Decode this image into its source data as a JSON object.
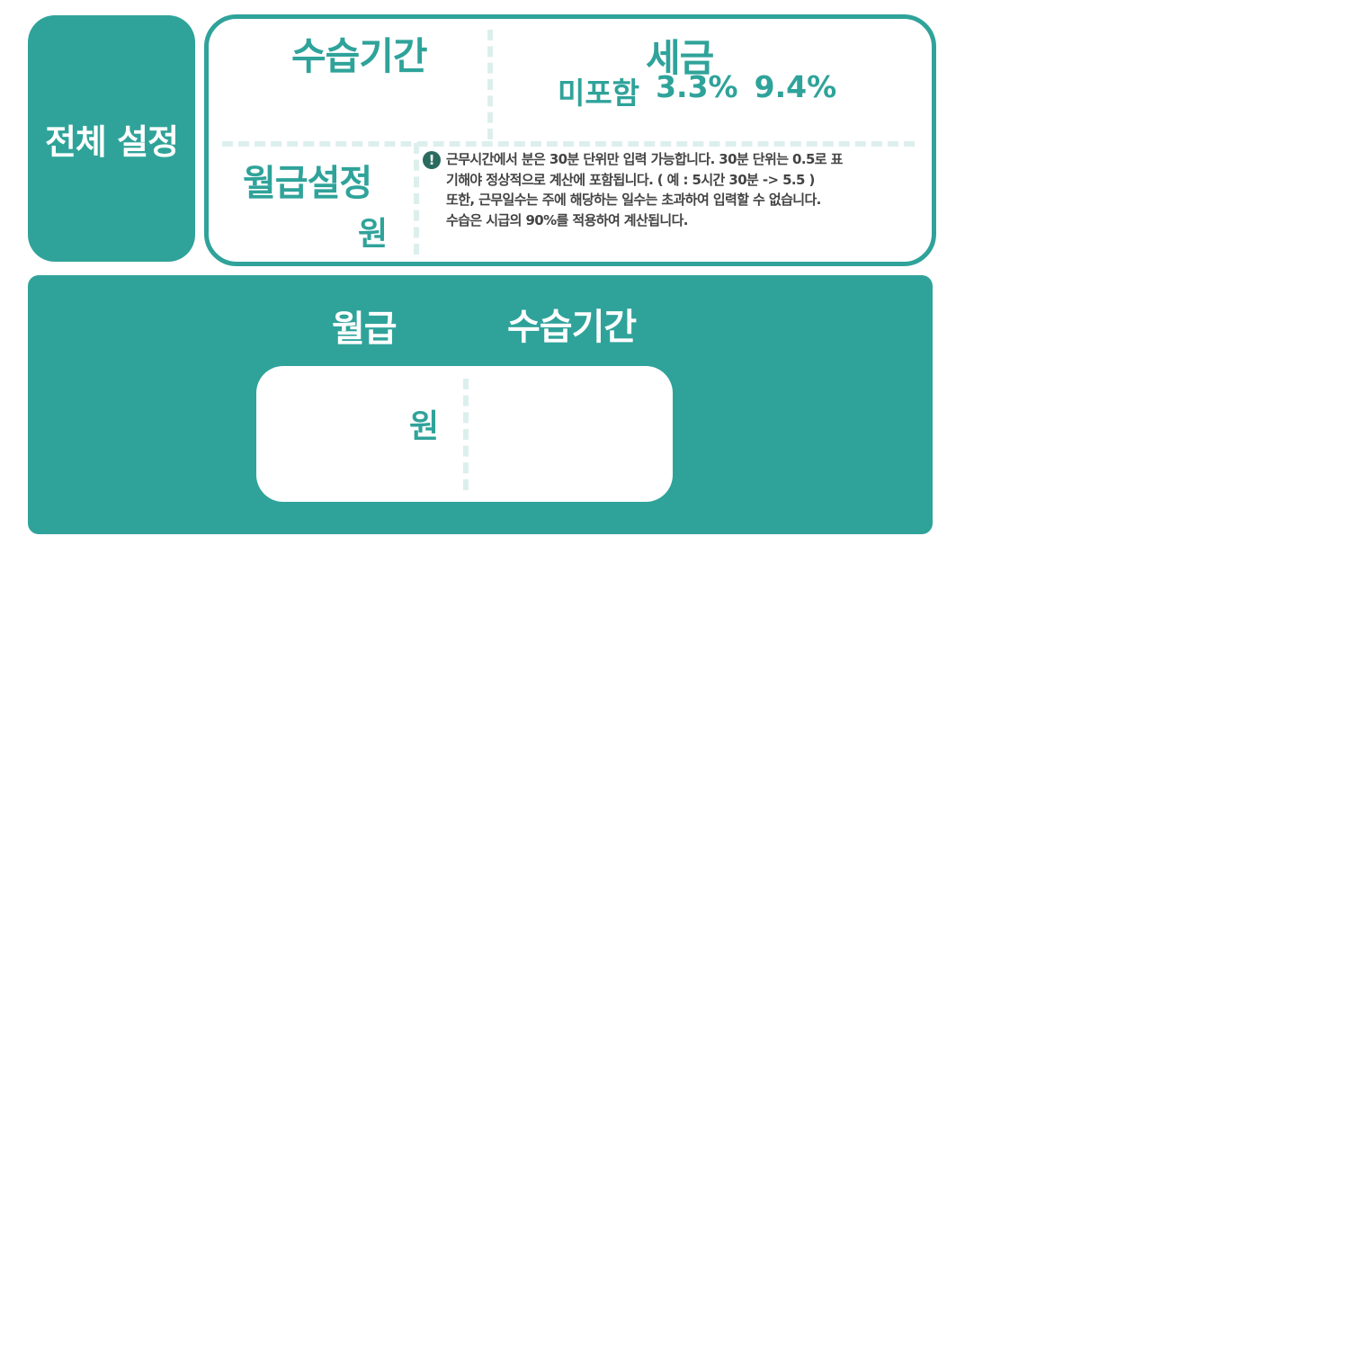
{
  "badge": {
    "label": "전체 설정"
  },
  "settings": {
    "probation_title": "수습기간",
    "tax_title": "세금",
    "tax_options": [
      "미포함",
      "3.3%",
      "9.4%"
    ],
    "salary_setting_title": "월급설정",
    "currency_unit": "원",
    "notice_icon": "!",
    "notice_lines": [
      "근무시간에서 분은 30분 단위만 입력 가능합니다. 30분 단위는 0.5로 표",
      "기해야 정상적으로 계산에 포함됩니다. ( 예 : 5시간 30분 -> 5.5 )",
      "또한, 근무일수는 주에 해당하는 일수는 초과하여 입력할 수 없습니다.",
      "수습은 시급의 90%를 적용하여 계산됩니다."
    ]
  },
  "result": {
    "salary_label": "월급",
    "probation_label": "수습기간",
    "currency_unit": "원"
  },
  "colors": {
    "accent": "#2fa39a",
    "divider": "#dcefed",
    "notice_text": "#444444",
    "notice_icon": "#2a6b5f"
  }
}
